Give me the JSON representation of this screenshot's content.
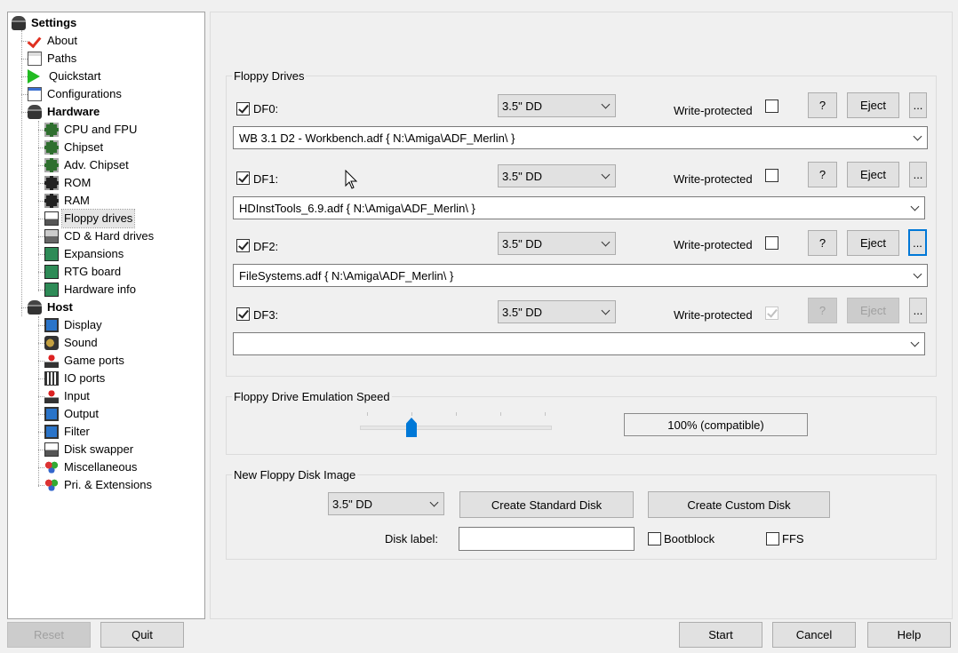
{
  "tree": {
    "root": {
      "label": "Settings",
      "icon": "settings-disk-icon"
    },
    "items": [
      {
        "label": "About",
        "icon": "about-check-icon"
      },
      {
        "label": "Paths",
        "icon": "paths-doc-icon"
      },
      {
        "label": "Quickstart",
        "icon": "quickstart-play-icon"
      },
      {
        "label": "Configurations",
        "icon": "configurations-icon"
      },
      {
        "label": "Hardware",
        "icon": "hardware-disk-icon"
      },
      {
        "label": "CPU and FPU",
        "icon": "chip-icon"
      },
      {
        "label": "Chipset",
        "icon": "chip-icon"
      },
      {
        "label": "Adv. Chipset",
        "icon": "chip-icon"
      },
      {
        "label": "ROM",
        "icon": "rom-chip-icon"
      },
      {
        "label": "RAM",
        "icon": "rom-chip-icon"
      },
      {
        "label": "Floppy drives",
        "icon": "floppy-icon"
      },
      {
        "label": "CD & Hard drives",
        "icon": "cd-drive-icon"
      },
      {
        "label": "Expansions",
        "icon": "expansion-card-icon"
      },
      {
        "label": "RTG board",
        "icon": "expansion-card-icon"
      },
      {
        "label": "Hardware info",
        "icon": "expansion-card-icon"
      },
      {
        "label": "Host",
        "icon": "host-disk-icon"
      },
      {
        "label": "Display",
        "icon": "monitor-icon"
      },
      {
        "label": "Sound",
        "icon": "speaker-icon"
      },
      {
        "label": "Game ports",
        "icon": "joystick-icon"
      },
      {
        "label": "IO ports",
        "icon": "io-port-icon"
      },
      {
        "label": "Input",
        "icon": "joystick-icon"
      },
      {
        "label": "Output",
        "icon": "output-icon"
      },
      {
        "label": "Filter",
        "icon": "monitor-icon"
      },
      {
        "label": "Disk swapper",
        "icon": "floppy-icon"
      },
      {
        "label": "Miscellaneous",
        "icon": "misc-balls-icon"
      },
      {
        "label": "Pri. & Extensions",
        "icon": "misc-balls-icon"
      }
    ],
    "selected": "Floppy drives"
  },
  "floppy_drives": {
    "title": "Floppy Drives",
    "write_protected_label": "Write-protected",
    "help_label": "?",
    "eject_label": "Eject",
    "browse_label": "...",
    "drives": [
      {
        "name": "DF0:",
        "enabled": true,
        "type": "3.5\" DD",
        "write_protected": false,
        "path": "WB 3.1 D2 - Workbench.adf { N:\\Amiga\\ADF_Merlin\\ }"
      },
      {
        "name": "DF1:",
        "enabled": true,
        "type": "3.5\" DD",
        "write_protected": false,
        "path": "HDInstTools_6.9.adf { N:\\Amiga\\ADF_Merlin\\ }"
      },
      {
        "name": "DF2:",
        "enabled": true,
        "type": "3.5\" DD",
        "write_protected": false,
        "path": "FileSystems.adf { N:\\Amiga\\ADF_Merlin\\ }"
      },
      {
        "name": "DF3:",
        "enabled": true,
        "type": "3.5\" DD",
        "write_protected": true,
        "path": ""
      }
    ]
  },
  "emulation_speed": {
    "title": "Floppy Drive Emulation Speed",
    "value_label": "100% (compatible)",
    "slider_position": 1,
    "slider_steps": 5
  },
  "new_image": {
    "title": "New Floppy Disk Image",
    "type": "3.5\" DD",
    "create_standard": "Create Standard Disk",
    "create_custom": "Create Custom Disk",
    "disk_label_caption": "Disk label:",
    "disk_label_value": "",
    "bootblock_label": "Bootblock",
    "bootblock_checked": false,
    "ffs_label": "FFS",
    "ffs_checked": false
  },
  "footer": {
    "reset": "Reset",
    "quit": "Quit",
    "start": "Start",
    "cancel": "Cancel",
    "help": "Help"
  }
}
